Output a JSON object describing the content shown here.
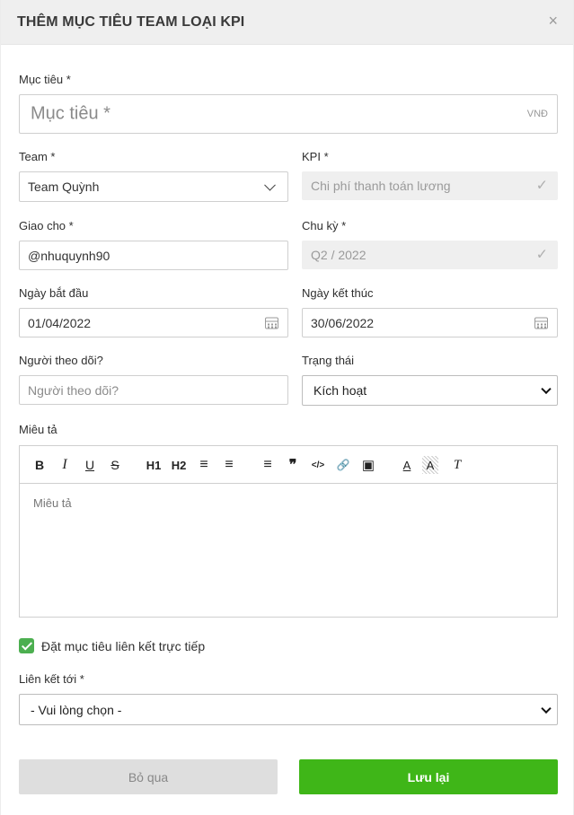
{
  "header": {
    "title": "THÊM MỤC TIÊU TEAM LOẠI KPI",
    "close": "×"
  },
  "goal": {
    "label": "Mục tiêu *",
    "placeholder": "Mục tiêu *",
    "unit": "VNĐ"
  },
  "team": {
    "label": "Team *",
    "value": "Team Quỳnh"
  },
  "kpi": {
    "label": "KPI *",
    "value": "Chi phí thanh toán lương",
    "check": "✓"
  },
  "assignee": {
    "label": "Giao cho *",
    "value": "@nhuquynh90"
  },
  "cycle": {
    "label": "Chu kỳ *",
    "value": "Q2 / 2022",
    "check": "✓"
  },
  "start_date": {
    "label": "Ngày bắt đầu",
    "value": "01/04/2022"
  },
  "end_date": {
    "label": "Ngày kết thúc",
    "value": "30/06/2022"
  },
  "follower": {
    "label": "Người theo dõi?",
    "placeholder": "Người theo dõi?"
  },
  "status": {
    "label": "Trạng thái",
    "value": "Kích hoạt"
  },
  "description": {
    "label": "Miêu tả",
    "placeholder": "Miêu tả",
    "toolbar": [
      {
        "name": "bold-icon",
        "glyph": "B"
      },
      {
        "name": "italic-icon",
        "glyph": "I"
      },
      {
        "name": "underline-icon",
        "glyph": "U"
      },
      {
        "name": "strikethrough-icon",
        "glyph": "S"
      },
      {
        "name": "heading1-icon",
        "glyph": "H1"
      },
      {
        "name": "heading2-icon",
        "glyph": "H2"
      },
      {
        "name": "ordered-list-icon",
        "glyph": "≡"
      },
      {
        "name": "bullet-list-icon",
        "glyph": "≡"
      },
      {
        "name": "align-icon",
        "glyph": "≡"
      },
      {
        "name": "blockquote-icon",
        "glyph": "❞"
      },
      {
        "name": "code-icon",
        "glyph": "</>"
      },
      {
        "name": "link-icon",
        "glyph": "🔗"
      },
      {
        "name": "image-icon",
        "glyph": "▣"
      },
      {
        "name": "text-color-icon",
        "glyph": "A"
      },
      {
        "name": "background-color-icon",
        "glyph": "A"
      },
      {
        "name": "clear-format-icon",
        "glyph": "T"
      }
    ]
  },
  "direct_link": {
    "label": "Đặt mục tiêu liên kết trực tiếp",
    "checked": true
  },
  "link_to": {
    "label": "Liên kết tới *",
    "value": "- Vui lòng chọn -"
  },
  "buttons": {
    "skip": "Bỏ qua",
    "save": "Lưu lại"
  },
  "colors": {
    "save": "#3fb618",
    "checkbox": "#4caf50",
    "header_bg": "#efefef"
  }
}
